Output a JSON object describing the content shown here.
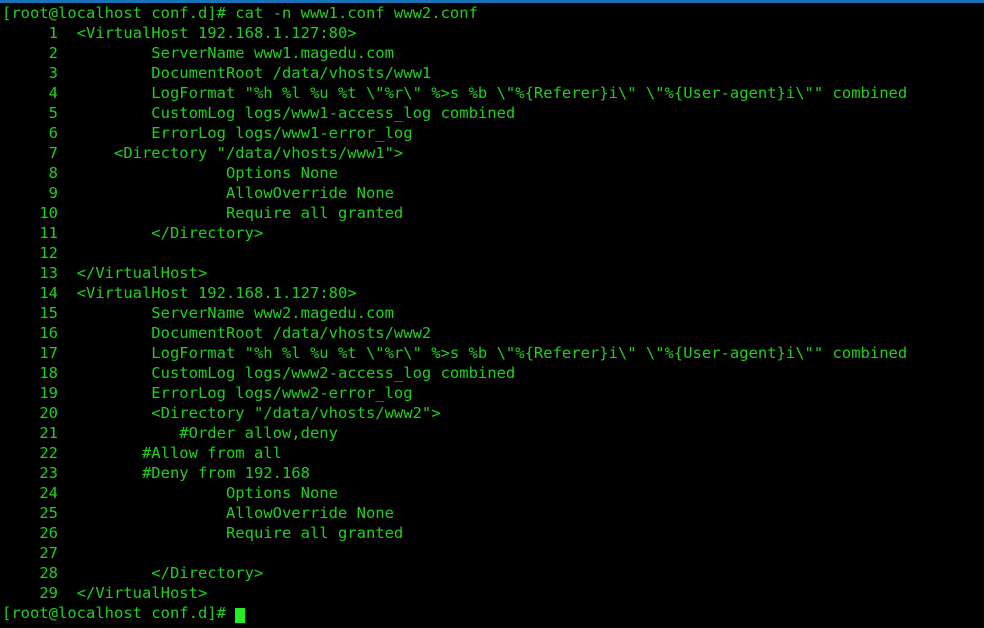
{
  "window": {
    "title_bar_color": "#1a72b8",
    "background_color": "#000000",
    "foreground_color": "#1fd11f",
    "cursor_color": "#22ee22"
  },
  "terminal": {
    "prompt": "[root@localhost conf.d]#",
    "command_line": "[root@localhost conf.d]# cat -n www1.conf www2.conf",
    "command": "cat -n www1.conf www2.conf",
    "final_prompt": "[root@localhost conf.d]# ",
    "files": [
      "www1.conf",
      "www2.conf"
    ],
    "lines": [
      {
        "num": "     1",
        "text": "\t<VirtualHost 192.168.1.127:80>"
      },
      {
        "num": "     2",
        "text": "\t        ServerName www1.magedu.com"
      },
      {
        "num": "     3",
        "text": "\t        DocumentRoot /data/vhosts/www1"
      },
      {
        "num": "     4",
        "text": "\t        LogFormat \"%h %l %u %t \\\"%r\\\" %>s %b \\\"%{Referer}i\\\" \\\"%{User-agent}i\\\"\" combined"
      },
      {
        "num": "     5",
        "text": "\t        CustomLog logs/www1-access_log combined"
      },
      {
        "num": "     6",
        "text": "\t        ErrorLog logs/www1-error_log"
      },
      {
        "num": "     7",
        "text": "\t    <Directory \"/data/vhosts/www1\">"
      },
      {
        "num": "     8",
        "text": "\t                Options None"
      },
      {
        "num": "     9",
        "text": "\t                AllowOverride None"
      },
      {
        "num": "    10",
        "text": "\t                Require all granted"
      },
      {
        "num": "    11",
        "text": "\t        </Directory>"
      },
      {
        "num": "    12",
        "text": "\t"
      },
      {
        "num": "    13",
        "text": "\t</VirtualHost>"
      },
      {
        "num": "    14",
        "text": "\t<VirtualHost 192.168.1.127:80>"
      },
      {
        "num": "    15",
        "text": "\t        ServerName www2.magedu.com"
      },
      {
        "num": "    16",
        "text": "\t        DocumentRoot /data/vhosts/www2"
      },
      {
        "num": "    17",
        "text": "\t        LogFormat \"%h %l %u %t \\\"%r\\\" %>s %b \\\"%{Referer}i\\\" \\\"%{User-agent}i\\\"\" combined"
      },
      {
        "num": "    18",
        "text": "\t        CustomLog logs/www2-access_log combined"
      },
      {
        "num": "    19",
        "text": "\t        ErrorLog logs/www2-error_log"
      },
      {
        "num": "    20",
        "text": "\t        <Directory \"/data/vhosts/www2\">"
      },
      {
        "num": "    21",
        "text": "\t           #Order allow,deny"
      },
      {
        "num": "    22",
        "text": "\t       #Allow from all"
      },
      {
        "num": "    23",
        "text": "\t       #Deny from 192.168"
      },
      {
        "num": "    24",
        "text": "\t                Options None"
      },
      {
        "num": "    25",
        "text": "\t                AllowOverride None"
      },
      {
        "num": "    26",
        "text": "\t                Require all granted"
      },
      {
        "num": "    27",
        "text": "\t"
      },
      {
        "num": "    28",
        "text": "\t        </Directory>"
      },
      {
        "num": "    29",
        "text": "\t</VirtualHost>"
      }
    ]
  }
}
